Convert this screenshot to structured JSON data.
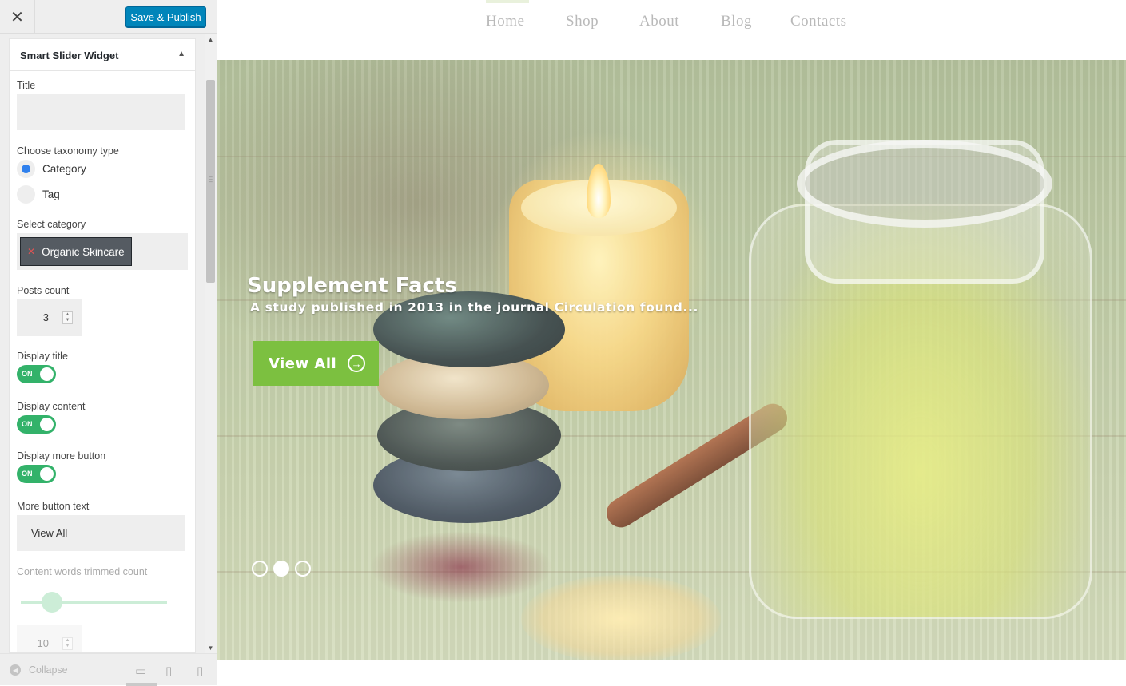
{
  "sidebar": {
    "close_icon": "close-icon",
    "publish_label": "Save & Publish",
    "widget": {
      "title": "Smart Slider Widget",
      "fields": {
        "title_label": "Title",
        "title_value": "",
        "taxonomy_label": "Choose taxonomy type",
        "taxonomy_options": [
          {
            "label": "Category",
            "checked": true
          },
          {
            "label": "Tag",
            "checked": false
          }
        ],
        "category_label": "Select category",
        "selected_category": "Organic Skincare",
        "posts_count_label": "Posts count",
        "posts_count_value": "3",
        "display_title_label": "Display title",
        "display_title_state": "ON",
        "display_content_label": "Display content",
        "display_content_state": "ON",
        "display_more_label": "Display more button",
        "display_more_state": "ON",
        "more_text_label": "More button text",
        "more_text_value": "View All",
        "trim_label": "Content words trimmed count",
        "trim_value": "10"
      }
    },
    "footer": {
      "collapse_label": "Collapse",
      "devices": [
        "desktop-icon",
        "tablet-icon",
        "mobile-icon"
      ],
      "active_device": "desktop"
    }
  },
  "preview": {
    "nav": [
      "Home",
      "Shop",
      "About",
      "Blog",
      "Contacts"
    ],
    "active_nav": "Home",
    "slider": {
      "title": "Supplement Facts",
      "text": "A study published in 2013 in the journal Circulation found...",
      "button_label": "View All",
      "dots": 3,
      "active_dot": 2
    }
  },
  "colors": {
    "publish": "#0085ba",
    "toggle_on": "#33b26a",
    "cta": "#7cc040",
    "radio_checked": "#2f80ed"
  }
}
